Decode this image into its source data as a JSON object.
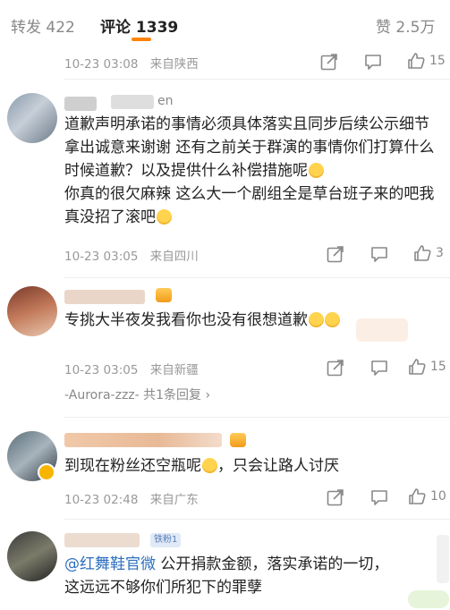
{
  "tabs": {
    "repost": "转发 422",
    "comment": "评论 1339",
    "like": "赞 2.5万"
  },
  "comments": [
    {
      "time": "10-23 03:08",
      "location": "来自陕西",
      "likes": "15"
    },
    {
      "name_suffix": "en",
      "text": "道歉声明承诺的事情必须具体落实且同步后续公示细节 拿出诚意来谢谢 还有之前关于群演的事情你们打算什么时候道歉？以及提供什么补偿措施呢",
      "text2": "你真的很欠麻辣 这么大一个剧组全是草台班子来的吧我真没招了滚吧",
      "time": "10-23 03:05",
      "location": "来自四川",
      "likes": "3"
    },
    {
      "text": "专挑大半夜发我看你也没有很想道歉",
      "time": "10-23 03:05",
      "location": "来自新疆",
      "likes": "15",
      "reply_text": "-Aurora-zzz- 共1条回复 ›"
    },
    {
      "text": "到现在粉丝还空瓶呢",
      "text_tail": "，只会让路人讨厌",
      "time": "10-23 02:48",
      "location": "来自广东",
      "likes": "10"
    },
    {
      "fan_badge": "铁粉1",
      "mention": "@红舞鞋官微",
      "text": " 公开捐款金额，落实承诺的一切，",
      "text2": "这远远不够你们所犯下的罪孽"
    }
  ],
  "icons": [
    "share-icon",
    "comment-icon",
    "like-icon"
  ],
  "colors": {
    "accent": "#ff8200",
    "link": "#2d6fbf",
    "meta": "#999999"
  }
}
